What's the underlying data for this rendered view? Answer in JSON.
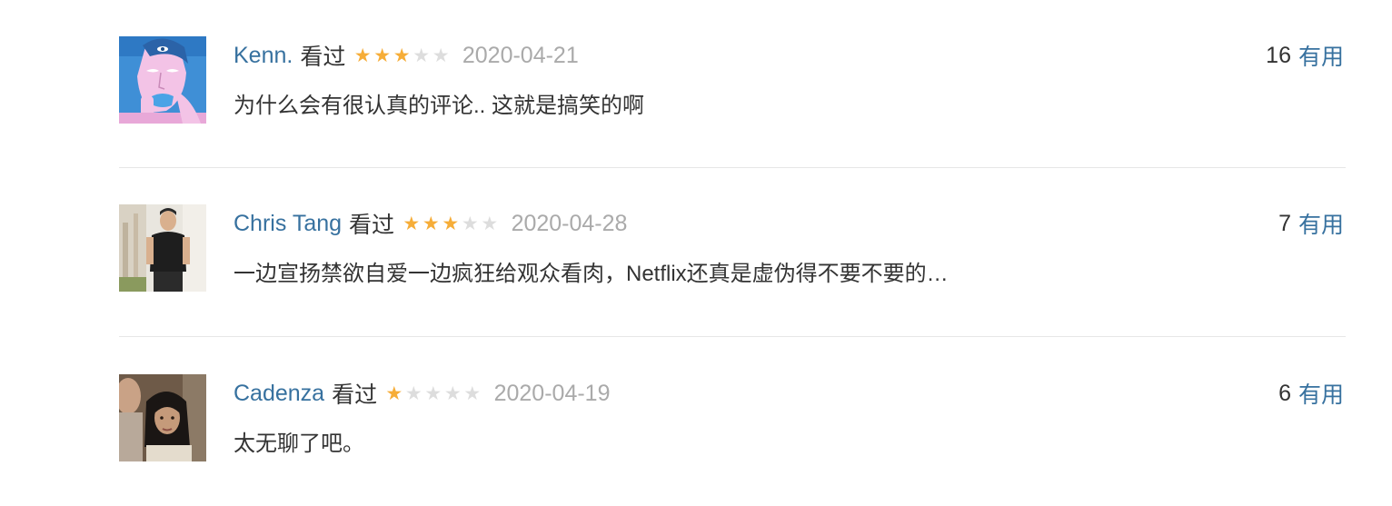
{
  "comments": [
    {
      "user": "Kenn.",
      "status": "看过",
      "rating": 3,
      "rating_max": 5,
      "date": "2020-04-21",
      "votes": "16",
      "vote_label": "有用",
      "text": "为什么会有很认真的评论.. 这就是搞笑的啊",
      "avatar_icon": "illustrated-face-avatar"
    },
    {
      "user": "Chris Tang",
      "status": "看过",
      "rating": 3,
      "rating_max": 5,
      "date": "2020-04-28",
      "votes": "7",
      "vote_label": "有用",
      "text": "一边宣扬禁欲自爱一边疯狂给观众看肉，Netflix还真是虚伪得不要不要的…",
      "avatar_icon": "man-in-black-shirt-photo-avatar"
    },
    {
      "user": "Cadenza",
      "status": "看过",
      "rating": 1,
      "rating_max": 5,
      "date": "2020-04-19",
      "votes": "6",
      "vote_label": "有用",
      "text": "太无聊了吧。",
      "avatar_icon": "film-still-woman-photo-avatar"
    }
  ],
  "colors": {
    "link": "#37719f",
    "star_on": "#f6ad38",
    "star_off": "#dddddd",
    "date": "#aaaaaa",
    "divider": "#e6e6e6"
  }
}
